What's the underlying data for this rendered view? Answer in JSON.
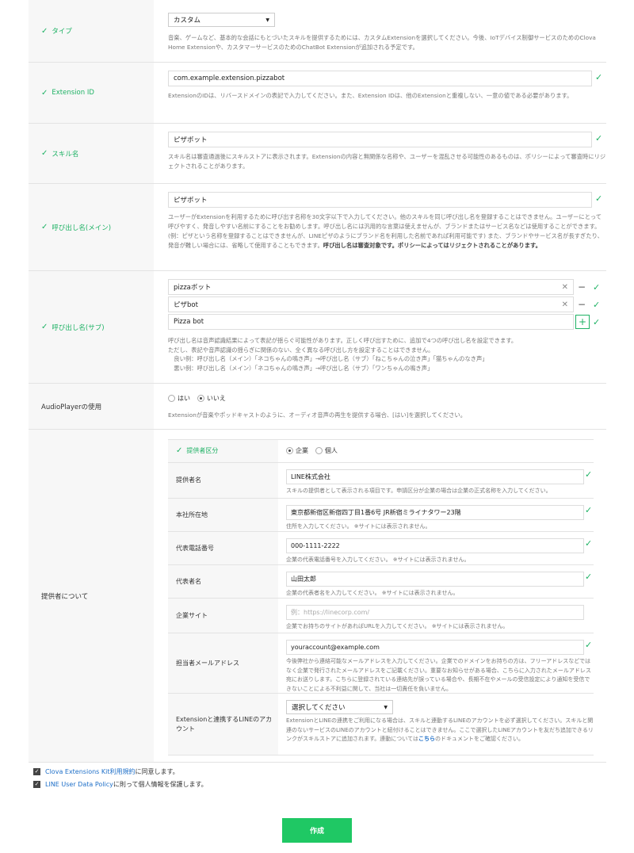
{
  "type_row": {
    "label": "タイプ",
    "select_value": "カスタム",
    "help": "音楽、ゲームなど、基本的な会話にもとづいたスキルを提供するためには、カスタムExtensionを選択してください。今後、IoTデバイス制御サービスのためのClova Home Extensionや、カスタマーサービスのためのChatBot Extensionが追加される予定です。"
  },
  "extension_id": {
    "label": "Extension ID",
    "value": "com.example.extension.pizzabot",
    "help": "ExtensionのIDは、リバースドメインの表記で入力してください。また、Extension IDは、他のExtensionと重複しない、一意の値である必要があります。"
  },
  "skill_name": {
    "label": "スキル名",
    "value": "ピザボット",
    "help": "スキル名は審査通過後にスキルストアに表示されます。Extensionの内容と無関係な名称や、ユーザーを混乱させる可能性のあるものは、ポリシーによって審査時にリジェクトされることがあります。"
  },
  "invocation_main": {
    "label": "呼び出し名(メイン)",
    "value": "ピザボット",
    "help": "ユーザーがExtensionを利用するために呼び出す名称を30文字以下で入力してください。他のスキルを同じ呼び出し名を登録することはできません。ユーザーにとって呼びやすく、発音しやすい名前にすることをお勧めします。呼び出し名には汎用的な言葉は使えませんが、ブランドまたはサービス名などは使用することができます。(例：ピザという名称を登録することはできませんが、LINEピザのようにブランド名を利用した名前であれば利用可能です) また、ブランドやサービス名が長すぎたり、発音が難しい場合には、省略して使用することもできます。",
    "help_bold": "呼び出し名は審査対象です。ポリシーによってはリジェクトされることがあります。"
  },
  "invocation_sub": {
    "label": "呼び出し名(サブ)",
    "items": [
      "pizzaボット",
      "ピザbot"
    ],
    "new_value": "Pizza bot",
    "help": [
      "呼び出し名は音声認識結果によって表記が揺らぐ可能性があります。正しく呼び出すために、追加で4つの呼び出し名を設定できます。",
      "ただし、表記や音声認識の揺らぎに関係のない、全く異なる呼び出し方を設定することはできません。",
      "　良い例：呼び出し名（メイン）「ネコちゃんの鳴き声」→呼び出し名（サブ）「ねこちゃんの泣き声」「猫ちゃんのなき声」",
      "　悪い例：呼び出し名（メイン）「ネコちゃんの鳴き声」→呼び出し名（サブ）「ワンちゃんの鳴き声」"
    ]
  },
  "audioplayer": {
    "label": "AudioPlayerの使用",
    "option_yes": "はい",
    "option_no": "いいえ",
    "help": "Extensionが音楽やポッドキャストのように、オーディオ音声の再生を提供する場合、[はい]を選択してください。"
  },
  "provider": {
    "label": "提供者について",
    "type_label": "提供者区分",
    "type_corp": "企業",
    "type_personal": "個人",
    "name_label": "提供者名",
    "name_value": "LINE株式会社",
    "name_help": "スキルの提供者として表示される項目です。申請区分が企業の場合は企業の正式名称を入力してください。",
    "address_label": "本社所在地",
    "address_value": "東京都新宿区新宿四丁目1番6号 JR新宿ミライナタワー23階",
    "address_help": "住所を入力してください。 ※サイトには表示されません。",
    "phone_label": "代表電話番号",
    "phone_value": "000-1111-2222",
    "phone_help": "企業の代表電話番号を入力してください。 ※サイトには表示されません。",
    "rep_label": "代表者名",
    "rep_value": "山田太郎",
    "rep_help": "企業の代表者名を入力してください。 ※サイトには表示されません。",
    "site_label": "企業サイト",
    "site_placeholder": "例：https://linecorp.com/",
    "site_help": "企業でお持ちのサイトがあればURLを入力してください。 ※サイトには表示されません。",
    "email_label": "担当者メールアドレス",
    "email_value": "youraccount@example.com",
    "email_help": "今後弊社から連絡可能なメールアドレスを入力してください。企業でのドメインをお持ちの方は、フリーアドレスなどではなく企業で発行されたメールアドレスをご記載ください。重要なお知らせがある場合、こちらに入力されたメールアドレス宛にお送りします。こちらに登録されている連絡先が誤っている場合や、長期不在やメールの受信設定により通知を受信できないことによる不利益に関して、当社は一切責任を負いません。",
    "line_label": "Extensionと連携するLINEのアカウント",
    "line_select": "選択してください",
    "line_help": "ExtensionとLINEの連携をご利用になる場合は、スキルと連動するLINEのアカウントを必ず選択してください。スキルと関連のないサービスのLINEのアカウントと紐付けることはできません。ここで選択したLINEアカウントを友だち追加できるリンクがスキルストアに追加されます。連動については",
    "line_help_link": "こちら",
    "line_help_tail": "のドキュメントをご確認ください。"
  },
  "agreements": {
    "terms_link": "Clova Extensions Kit利用規約",
    "terms_text": "に同意します。",
    "policy_link": "LINE User Data Policy",
    "policy_text": "に則って個人情報を保護します。"
  },
  "create_button": "作成"
}
